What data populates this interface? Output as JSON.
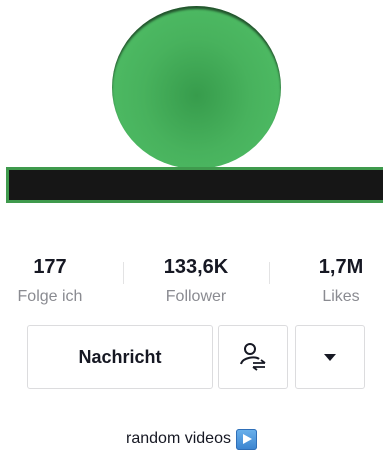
{
  "profile": {
    "avatar_color": "#4ab55f",
    "name_bar_color": "#161616",
    "name_bar_border_color": "#3f9a4d"
  },
  "stats": {
    "following_count": "177",
    "following_label": "Folge ich",
    "followers_count": "133,6K",
    "followers_label": "Follower",
    "likes_count": "1,7M",
    "likes_label": "Likes"
  },
  "actions": {
    "message_label": "Nachricht",
    "follow_icon": "user-swap-icon",
    "more_icon": "caret-down-icon"
  },
  "bio": {
    "text": "random videos",
    "icon": "play-button-icon"
  }
}
